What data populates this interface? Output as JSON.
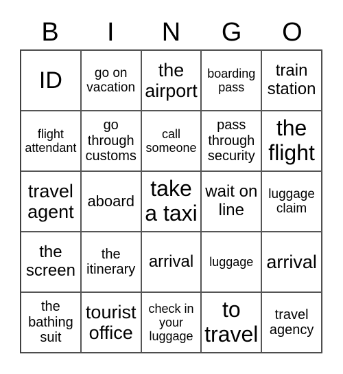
{
  "header": {
    "letters": [
      "B",
      "I",
      "N",
      "G",
      "O"
    ]
  },
  "cells": [
    "ID",
    "go on vacation",
    "the airport",
    "boarding pass",
    "train station",
    "flight attendant",
    "go through customs",
    "call someone",
    "pass through security",
    "the flight",
    "travel agent",
    "aboard",
    "take a taxi",
    "wait on line",
    "luggage claim",
    "the screen",
    "the itinerary",
    "arrival",
    "luggage",
    "arrival",
    "the bathing suit",
    "tourist office",
    "check in your luggage",
    "to travel",
    "travel agency"
  ]
}
